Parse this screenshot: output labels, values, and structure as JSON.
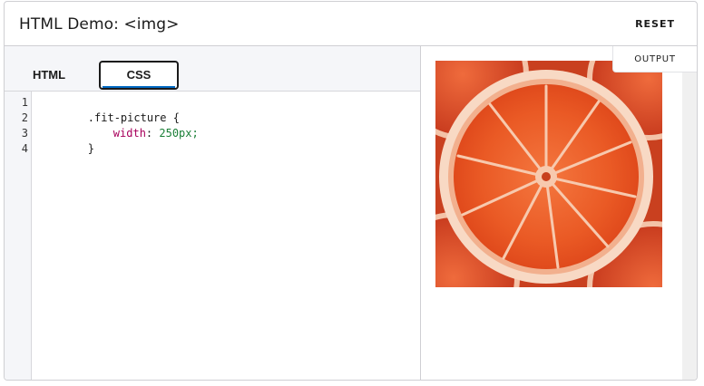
{
  "header": {
    "title": "HTML Demo: <img>",
    "reset_label": "RESET"
  },
  "tabs": [
    {
      "label": "HTML",
      "active": false
    },
    {
      "label": "CSS",
      "active": true
    }
  ],
  "editor": {
    "line_numbers": [
      "1",
      "2",
      "3",
      "4"
    ],
    "lines": [
      {
        "selector": ".fit-picture {"
      },
      {
        "property": "width",
        "value": "250px;"
      },
      {
        "selector": "}"
      },
      {
        "selector": ""
      }
    ]
  },
  "output": {
    "label": "OUTPUT",
    "image_name": "grapefruit slice"
  },
  "colors": {
    "accent": "#0069c2",
    "property": "#a8005c",
    "value": "#1a7f37",
    "grapefruit": "#e8532a"
  }
}
